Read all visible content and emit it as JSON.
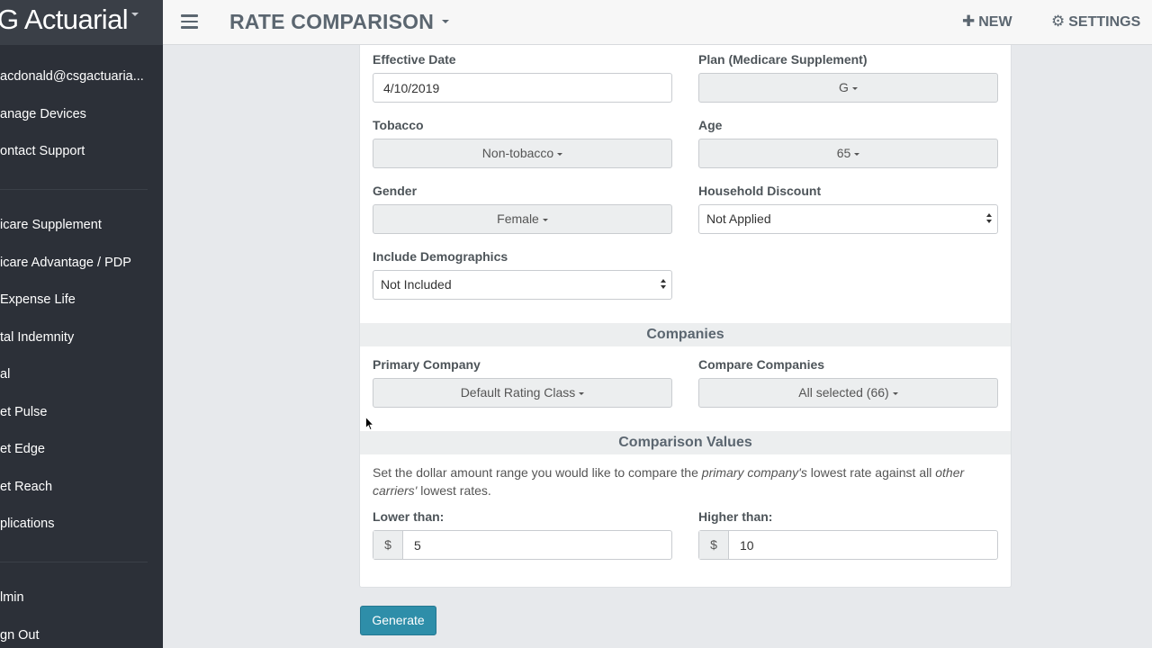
{
  "sidebar": {
    "brand": "G Actuarial",
    "items": [
      {
        "label": "acdonald@csgactuaria..."
      },
      {
        "label": "anage Devices"
      },
      {
        "label": "ontact Support"
      },
      {
        "label": "icare Supplement"
      },
      {
        "label": "icare Advantage / PDP"
      },
      {
        "label": "Expense Life"
      },
      {
        "label": "tal Indemnity"
      },
      {
        "label": "al"
      },
      {
        "label": "et Pulse"
      },
      {
        "label": "et Edge"
      },
      {
        "label": "et Reach"
      },
      {
        "label": "plications"
      },
      {
        "label": "lmin"
      },
      {
        "label": "gn Out"
      }
    ]
  },
  "header": {
    "title": "RATE COMPARISON",
    "new_label": "NEW",
    "settings_label": "SETTINGS",
    "new_icon": "plus-icon",
    "settings_icon": "gear-icon"
  },
  "form": {
    "effective_date": {
      "label": "Effective Date",
      "value": "4/10/2019"
    },
    "plan": {
      "label": "Plan (Medicare Supplement)",
      "value": "G"
    },
    "tobacco": {
      "label": "Tobacco",
      "value": "Non-tobacco"
    },
    "age": {
      "label": "Age",
      "value": "65"
    },
    "gender": {
      "label": "Gender",
      "value": "Female"
    },
    "household_discount": {
      "label": "Household Discount",
      "value": "Not Applied"
    },
    "include_demographics": {
      "label": "Include Demographics",
      "value": "Not Included"
    }
  },
  "companies": {
    "heading": "Companies",
    "primary": {
      "label": "Primary Company",
      "value": "Default Rating Class"
    },
    "compare": {
      "label": "Compare Companies",
      "value": "All selected (66)"
    }
  },
  "comparison": {
    "heading": "Comparison Values",
    "desc_part1": "Set the dollar amount range you would like to compare the ",
    "desc_em1": "primary company's",
    "desc_part2": " lowest rate against all ",
    "desc_em2": "other carriers'",
    "desc_part3": " lowest rates.",
    "lower": {
      "label": "Lower than:",
      "currency": "$",
      "value": "5"
    },
    "higher": {
      "label": "Higher than:",
      "currency": "$",
      "value": "10"
    }
  },
  "actions": {
    "generate_label": "Generate"
  },
  "colors": {
    "sidebar_bg": "#2c3038",
    "brand_bg": "#3a3f47",
    "header_text": "#5b6670",
    "primary_button": "#2e8ea9"
  }
}
